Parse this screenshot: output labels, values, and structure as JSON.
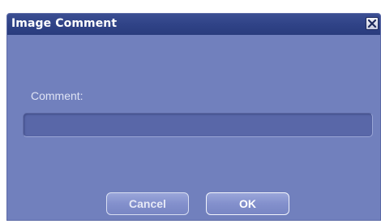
{
  "dialog": {
    "title": "Image Comment",
    "close_icon": "close-x-icon",
    "comment_label": "Comment:",
    "comment_value": "",
    "comment_placeholder": "",
    "cancel_label": "Cancel",
    "ok_label": "OK"
  },
  "colors": {
    "dialog_background": "#7180bd",
    "titlebar": "#2f4286",
    "field_background": "#5967a8",
    "button_background": "#8390cc"
  }
}
